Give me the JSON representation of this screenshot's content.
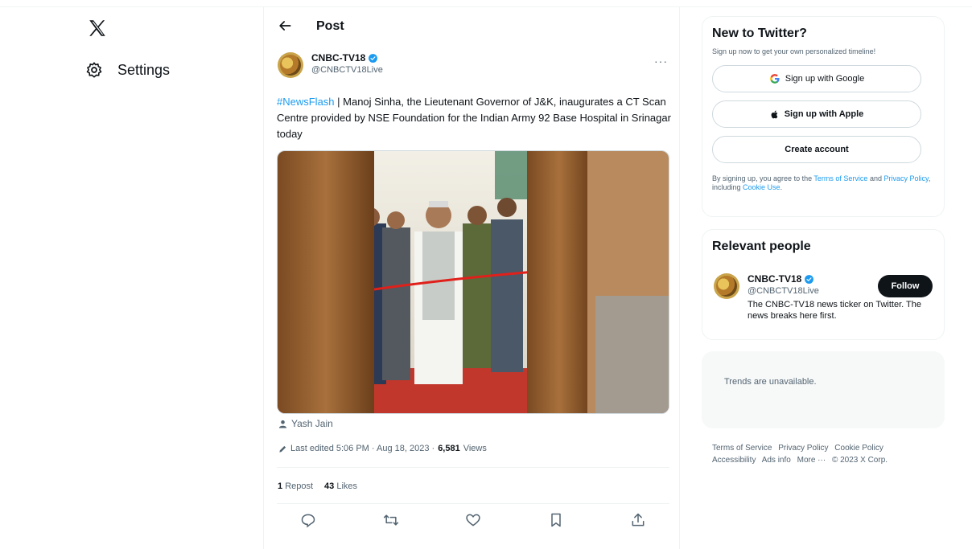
{
  "nav": {
    "settings_label": "Settings"
  },
  "header": {
    "title": "Post"
  },
  "tweet": {
    "author_name": "CNBC-TV18",
    "author_handle": "@CNBCTV18Live",
    "hashtag": "#NewsFlash",
    "text": " | Manoj Sinha, the Lieutenant Governor of J&K, inaugurates a CT Scan Centre provided by NSE Foundation for the Indian Army 92 Base Hospital in Srinagar today",
    "media_credit": "Yash Jain",
    "edited_prefix": "Last edited 5:06 PM · Aug 18, 2023 · ",
    "views_count": "6,581",
    "views_label": "Views",
    "reposts_count": "1",
    "reposts_label": "Repost",
    "likes_count": "43",
    "likes_label": "Likes",
    "more_label": "···"
  },
  "signup": {
    "title": "New to Twitter?",
    "subtitle": "Sign up now to get your own personalized timeline!",
    "google_label": "Sign up with Google",
    "apple_label": "Sign up with Apple",
    "create_label": "Create account",
    "legal_prefix": "By signing up, you agree to the ",
    "terms_link": "Terms of Service",
    "legal_and": " and ",
    "privacy_link": "Privacy Policy",
    "legal_including": ", including ",
    "cookie_link": "Cookie Use",
    "legal_end": "."
  },
  "relevant": {
    "title": "Relevant people",
    "name": "CNBC-TV18",
    "handle": "@CNBCTV18Live",
    "bio": "The CNBC-TV18 news ticker on Twitter. The news breaks here first.",
    "follow_label": "Follow"
  },
  "trends": {
    "text": "Trends are unavailable."
  },
  "footer": {
    "links": [
      "Terms of Service",
      "Privacy Policy",
      "Cookie Policy",
      "Accessibility",
      "Ads info",
      "More ···",
      "© 2023 X Corp."
    ]
  },
  "colors": {
    "accent": "#1d9bf0",
    "text": "#0f1419",
    "muted": "#536471"
  }
}
